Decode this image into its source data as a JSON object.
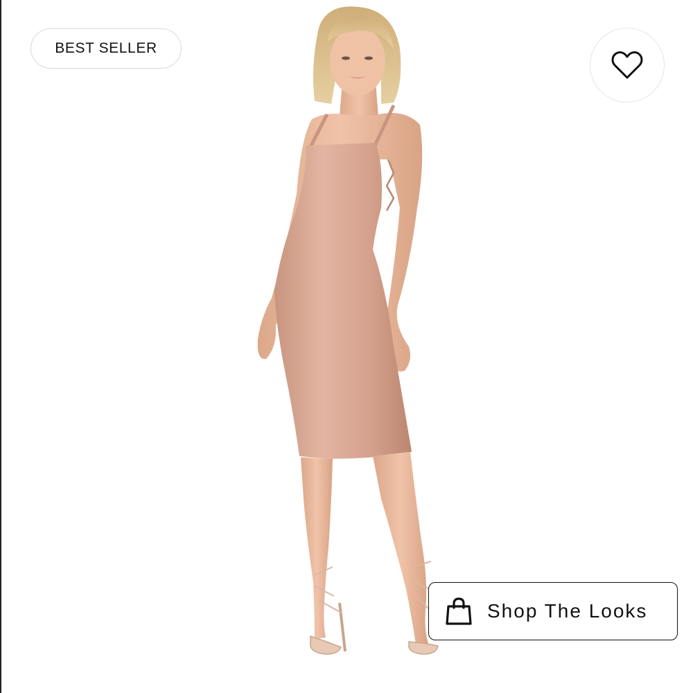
{
  "badge": {
    "label": "BEST SELLER"
  },
  "favorite": {
    "icon": "heart-outline-icon"
  },
  "shop_looks": {
    "label": "Shop The Looks",
    "icon": "shopping-bag-icon"
  },
  "colors": {
    "dress": "#d6a794",
    "skin": "#e8b79c",
    "hair": "#dcc08e",
    "border": "#111111"
  }
}
